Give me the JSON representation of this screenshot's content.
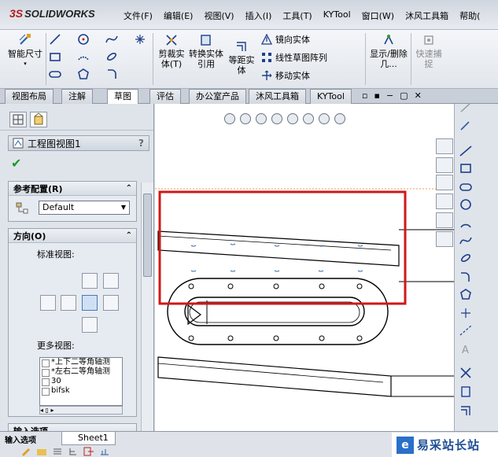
{
  "app": {
    "brand": "SOLIDWORKS"
  },
  "menu": [
    "文件(F)",
    "编辑(E)",
    "视图(V)",
    "插入(I)",
    "工具(T)",
    "KYTool",
    "窗口(W)",
    "沐风工具箱",
    "帮助("
  ],
  "commands": {
    "smart_dim": "智能尺寸",
    "trim": "剪裁实体(T)",
    "convert": "转换实体引用",
    "offset": "等距实体",
    "mirror": "镜向实体",
    "linear_pattern": "线性草图阵列",
    "move": "移动实体",
    "show_delete": "显示/删除几...",
    "quick_snap": "快速捕捉"
  },
  "tabs": [
    "视图布局",
    "注解",
    "草图",
    "评估",
    "办公室产品",
    "沐风工具箱",
    "KYTool"
  ],
  "active_tab": "草图",
  "panel": {
    "title": "工程图视图1",
    "help": "?",
    "ref_config": {
      "label": "参考配置(R)",
      "value": "Default"
    },
    "orientation": {
      "label": "方向(O)",
      "std_views": "标准视图:",
      "more_views": "更多视图:"
    },
    "more_views_list": [
      "*上下二等角轴测",
      "*左右二等角轴测",
      "30",
      "bifsk"
    ],
    "input_section": "输入选项"
  },
  "sheet_tab": "Sheet1",
  "watermark": "易采站长站",
  "colors": {
    "highlight_rect": "#d01818",
    "brand_red": "#b31b1b"
  }
}
